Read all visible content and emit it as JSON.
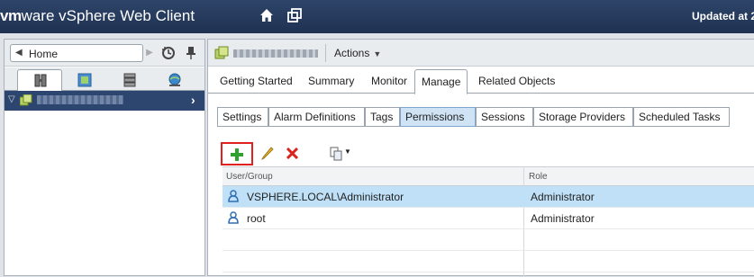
{
  "header": {
    "brand_vm": "vm",
    "brand_ware": "ware",
    "brand_title": " vSphere Web Client",
    "updated_text": "Updated at 2"
  },
  "navigator": {
    "home_label": "Home"
  },
  "object": {
    "actions_label": "Actions"
  },
  "tabs": [
    {
      "label": "Getting Started"
    },
    {
      "label": "Summary"
    },
    {
      "label": "Monitor"
    },
    {
      "label": "Manage"
    },
    {
      "label": "Related Objects"
    }
  ],
  "subtabs": [
    {
      "label": "Settings"
    },
    {
      "label": "Alarm Definitions"
    },
    {
      "label": "Tags"
    },
    {
      "label": "Permissions"
    },
    {
      "label": "Sessions"
    },
    {
      "label": "Storage Providers"
    },
    {
      "label": "Scheduled Tasks"
    }
  ],
  "active_tab": "Manage",
  "active_subtab": "Permissions",
  "permissions": {
    "columns": [
      "User/Group",
      "Role"
    ],
    "rows": [
      {
        "user": "VSPHERE.LOCAL\\Administrator",
        "role": "Administrator"
      },
      {
        "user": "root",
        "role": "Administrator"
      }
    ]
  },
  "colors": {
    "header_bg": "#26395a",
    "selection": "#bfe0f7",
    "add_highlight": "#e0201e"
  }
}
